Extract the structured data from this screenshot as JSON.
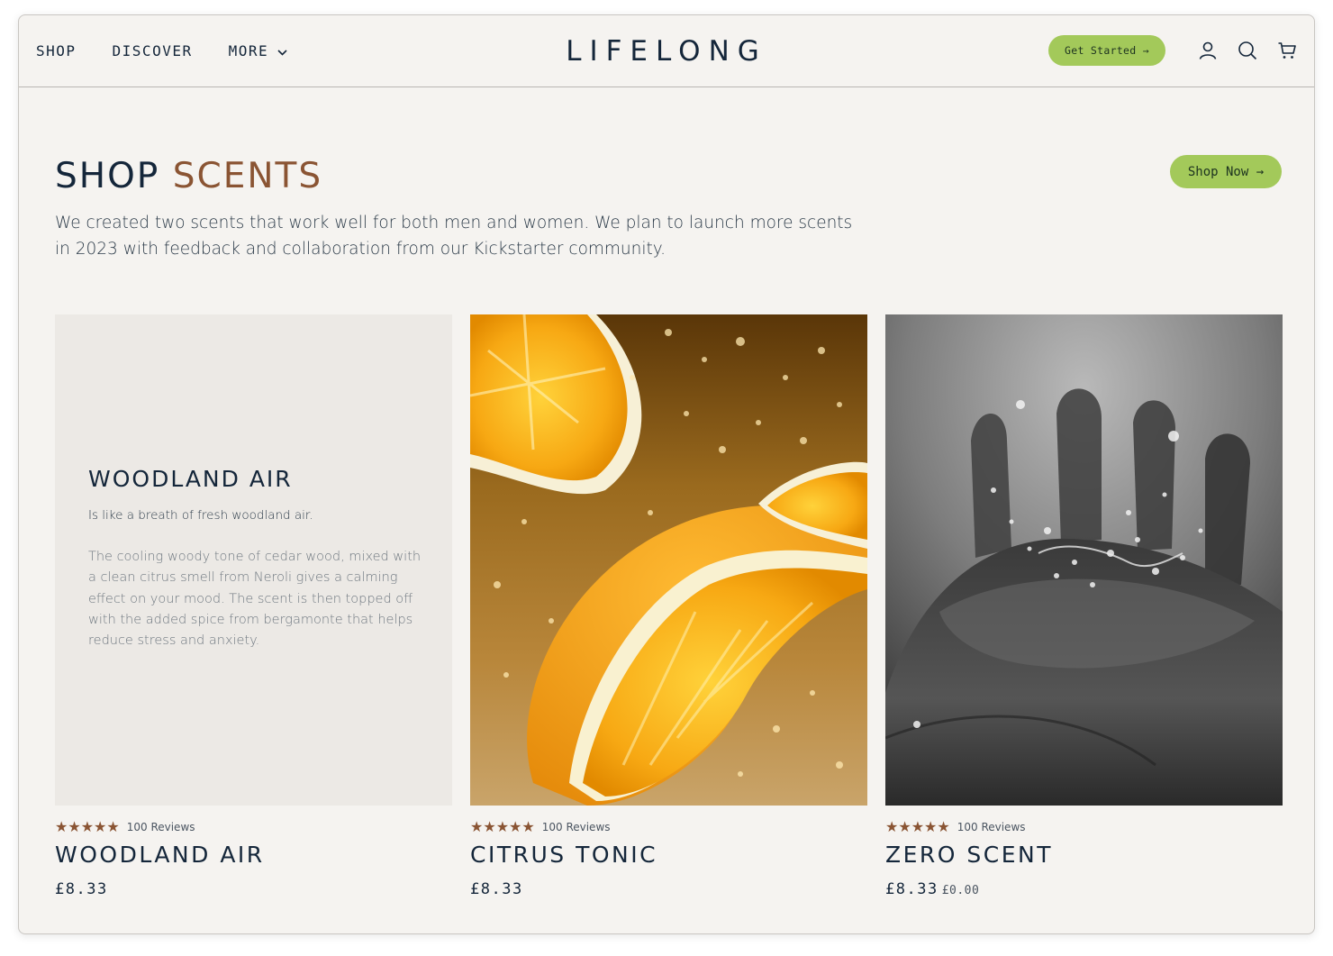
{
  "header": {
    "nav": [
      {
        "label": "SHOP"
      },
      {
        "label": "DISCOVER"
      },
      {
        "label": "MORE"
      }
    ],
    "logo": "LIFELONG",
    "cta_label": "Get Started →",
    "icons": [
      "user-icon",
      "search-icon",
      "cart-icon"
    ]
  },
  "hero": {
    "title_part1": "SHOP",
    "title_part2": "SCENTS",
    "shop_now_label": "Shop Now →",
    "intro": "We created two scents that work well for both men and women. We plan to launch more scents in 2023 with feedback and collaboration from our Kickstarter community."
  },
  "featured_panel": {
    "title": "WOODLAND AIR",
    "subtitle": "Is like a breath of fresh woodland air.",
    "description": "The cooling woody tone of cedar wood, mixed with a clean citrus smell from Neroli gives a calming effect on your mood. The scent is then topped off with the added spice from bergamonte that helps reduce stress and anxiety."
  },
  "products": [
    {
      "stars": "★★★★★",
      "reviews": "100 Reviews",
      "name": "WOODLAND AIR",
      "price": "£8.33",
      "old_price": ""
    },
    {
      "stars": "★★★★★",
      "reviews": "100 Reviews",
      "name": "CITRUS TONIC",
      "price": "£8.33",
      "old_price": ""
    },
    {
      "stars": "★★★★★",
      "reviews": "100 Reviews",
      "name": "ZERO SCENT",
      "price": "£8.33",
      "old_price": "£0.00"
    }
  ],
  "colors": {
    "navy": "#14263a",
    "brown_accent": "#8a5433",
    "green_button": "#a3c95a",
    "background": "#f5f3f0"
  }
}
